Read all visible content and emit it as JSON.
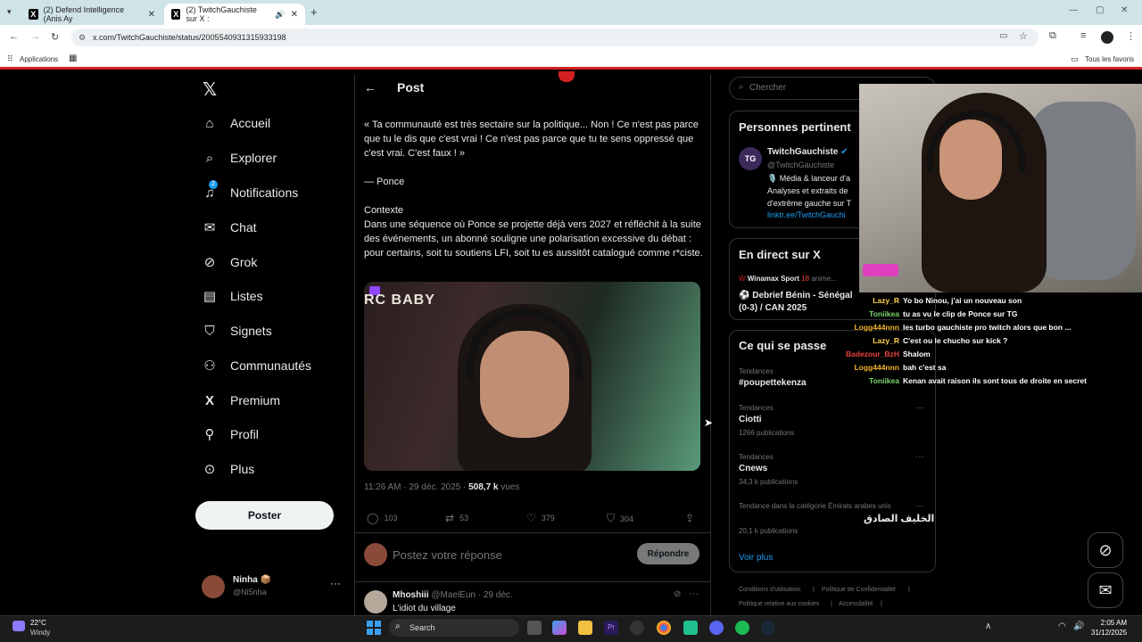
{
  "browser": {
    "tabs": [
      {
        "title": "(2) Defend Intelligence (Anis Ay",
        "active": false
      },
      {
        "title": "(2) TwitchGauchiste sur X :",
        "active": true
      }
    ],
    "url": "x.com/TwitchGauchiste/status/2005540931315933198",
    "bookmarks": {
      "apps": "Applications",
      "all": "Tous les favoris"
    }
  },
  "nav": {
    "items": [
      {
        "label": "Accueil",
        "icon": "home-icon"
      },
      {
        "label": "Explorer",
        "icon": "search-icon"
      },
      {
        "label": "Notifications",
        "icon": "bell-icon",
        "badge": "2"
      },
      {
        "label": "Chat",
        "icon": "mail-icon"
      },
      {
        "label": "Grok",
        "icon": "grok-icon"
      },
      {
        "label": "Listes",
        "icon": "list-icon"
      },
      {
        "label": "Signets",
        "icon": "bookmark-icon"
      },
      {
        "label": "Communautés",
        "icon": "people-icon"
      },
      {
        "label": "Premium",
        "icon": "x-icon"
      },
      {
        "label": "Profil",
        "icon": "person-icon"
      },
      {
        "label": "Plus",
        "icon": "more-icon"
      }
    ],
    "post_button": "Poster",
    "account": {
      "name": "Ninha",
      "handle": "@Ni5nha"
    }
  },
  "post": {
    "header": "Post",
    "quote": "« Ta communauté est très sectaire sur la politique... Non ! Ce n'est pas parce que tu le dis que c'est vrai ! Ce n'est pas parce que tu te sens oppressé que c'est vrai. C'est faux ! »",
    "author_line": "— Ponce",
    "context_title": "Contexte",
    "context_body": "Dans une séquence où Ponce se projette déjà vers 2027 et réfléchit à la suite des événements, un abonné souligne une polarisation excessive du débat : pour certains, soit tu soutiens LFI, soit tu es aussitôt catalogué comme r*ciste.",
    "video_overlay": "RC BABY",
    "timestamp": "11:26 AM · 29 déc. 2025 · ",
    "views": "508,7 k",
    "views_label": "vues",
    "stats": {
      "replies": "103",
      "reposts": "53",
      "likes": "379",
      "bookmarks": "304"
    },
    "reply_placeholder": "Postez votre réponse",
    "reply_button": "Répondre",
    "reply": {
      "name": "Mhoshiii",
      "handle": "@MaelEun",
      "date": "· 29 déc.",
      "text": "L'idiot du village"
    }
  },
  "sidebar": {
    "search_placeholder": "Chercher",
    "relevant": {
      "title": "Personnes pertinent",
      "name": "TwitchGauchiste",
      "handle": "@TwitchGauchiste",
      "bio1": "🎙️ Média & lanceur d'a",
      "bio2": "Analyses et extraits de",
      "bio3": "d'extrême gauche sur T",
      "link": "linktr.ee/TwitchGauchi"
    },
    "live": {
      "title": "En direct sur X",
      "host": "Winamax Sport",
      "host_extra": "anime...",
      "event1": "⚽ Debrief Bénin - Sénégal",
      "event2": "(0-3) / CAN 2025"
    },
    "trends": {
      "title": "Ce qui se passe",
      "items": [
        {
          "category": "Tendances",
          "name": "#poupettekenza",
          "count": ""
        },
        {
          "category": "Tendances",
          "name": "Ciotti",
          "count": "1266 publications"
        },
        {
          "category": "Tendances",
          "name": "Cnews",
          "count": "34,3 k publications"
        },
        {
          "category": "Tendance dans la catégorie Émirats arabes unis",
          "name": "الخليف الصادق",
          "count": "20,1 k publications"
        }
      ],
      "more": "Voir plus"
    },
    "footer": [
      "Conditions d'utilisation",
      "Politique de Confidentialité",
      "Politique relative aux cookies",
      "Accessibilité"
    ]
  },
  "chat": [
    {
      "user": "Lazy_R",
      "text": "Yo bo Ninou, j'ai un nouveau son",
      "color": "#ffd34d"
    },
    {
      "user": "Toniikea",
      "text": "tu as vu le clip de Ponce sur TG",
      "color": "#7ad46b"
    },
    {
      "user": "Logg444nnn",
      "text": "les turbo gauchiste pro twitch alors que bon ...",
      "color": "#f0b429"
    },
    {
      "user": "Lazy_R",
      "text": "C'est ou le chucho sur kick ?",
      "color": "#ffd34d"
    },
    {
      "user": "Badezour_BzH",
      "text": "Shalom",
      "color": "#e8423b"
    },
    {
      "user": "Logg444nnn",
      "text": "bah c'est sa",
      "color": "#f0b429"
    },
    {
      "user": "Toniikea",
      "text": "Kenan avait raison ils sont tous de droite en secret",
      "color": "#7ad46b"
    }
  ],
  "taskbar": {
    "weather_temp": "22°C",
    "weather_desc": "Windy",
    "search": "Search",
    "time": "2:05 AM",
    "date": "31/12/2025"
  }
}
